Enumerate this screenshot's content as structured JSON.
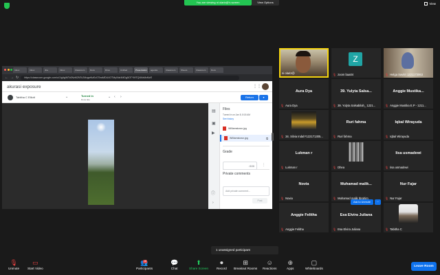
{
  "top": {
    "banner": "You are viewing ni olariz@'s screen",
    "view_options": "View Options",
    "view_label": "View"
  },
  "share": {
    "tabs": [
      "Inbox",
      "Inbox",
      "Jira",
      "Inbox",
      "Classroom",
      "Docs",
      "Drive",
      "Untitled",
      "Presentation",
      "agenda",
      "Classroom",
      "Sheets",
      "Classroom",
      "Docs"
    ],
    "url": "https://classroom.google.com/u/1/g/tg/MTc0NzM2NTc2MzgwNzEzOTcwMDU4OTMy/NzI4MDg5OTYMTQ4MzMzMzE",
    "course_title": "akurasi exposure",
    "student_name": "Tabitha C Elliott",
    "status": "Turned in",
    "status_sub": "Done late",
    "return_label": "Return",
    "files_heading": "Files",
    "files_sub": "Turned in on Jan 8, 8:18 AM",
    "see_history": "See history",
    "files": [
      "Williamstown.jpg",
      "Williamstown.jpg"
    ],
    "grade_heading": "Grade",
    "grade_value": "/100",
    "private_heading": "Private comments",
    "comment_placeholder": "Add private comment...",
    "post_label": "Post"
  },
  "gallery": [
    {
      "caption": "ni olariz@",
      "big": "",
      "kind": "video-person"
    },
    {
      "caption": "zoom baa04",
      "big": "",
      "kind": "avatar-z"
    },
    {
      "caption": "Helga Savitri 1221173063",
      "big": "",
      "kind": "video-hijab"
    },
    {
      "caption": "Aura Dya",
      "big": "Aura Dya",
      "kind": "name"
    },
    {
      "caption": "39. Yulyta Salsabilah_ 1221...",
      "big": "39. Yulyta Salsa...",
      "kind": "name"
    },
    {
      "caption": "Anggie Mustika E.P - 1211...",
      "big": "Anggie Mustika...",
      "kind": "name"
    },
    {
      "caption": "34. Silvia Indah*122171305...",
      "big": "",
      "kind": "video-dark"
    },
    {
      "caption": "Ruri fahma",
      "big": "Ruri fahma",
      "kind": "name"
    },
    {
      "caption": "Iqbal Wirayuda",
      "big": "Iqbal Wirayuda",
      "kind": "name"
    },
    {
      "caption": "Lukman r",
      "big": "Lukman r",
      "kind": "name"
    },
    {
      "caption": "Dhea",
      "big": "",
      "kind": "video-stripes"
    },
    {
      "caption": "Iisa usmadewi",
      "big": "Iisa usmadewi",
      "kind": "name"
    },
    {
      "caption": "Novia",
      "big": "Novia",
      "kind": "name"
    },
    {
      "caption": "Muhamad malik Ibrahim",
      "big": "Muhamad malik...",
      "kind": "name"
    },
    {
      "caption": "Nur Fajar",
      "big": "Nur Fajar",
      "kind": "name"
    },
    {
      "caption": "Anggie Felitha",
      "big": "Anggie Felitha",
      "kind": "name"
    },
    {
      "caption": "Esa Elvira Juliana",
      "big": "Esa Elvira Juliana",
      "kind": "name"
    },
    {
      "caption": "Tabitha C",
      "big": "",
      "kind": "video-photo"
    }
  ],
  "ask_unmute": "Ask to Unmute",
  "unassigned": "1 unassigned participant",
  "toolbar": {
    "unmute": "Unmute",
    "start_video": "Start Video",
    "participants": "Participants",
    "participants_count": "18",
    "chat": "Chat",
    "share_screen": "Share Screen",
    "record": "Record",
    "breakout": "Breakout Rooms",
    "reactions": "Reactions",
    "apps": "Apps",
    "whiteboards": "Whiteboards",
    "leave": "Leave Room"
  },
  "colors": {
    "accent": "#0e72ed",
    "green": "#23c552",
    "active_speaker": "#f5d40f",
    "muted": "#e34040"
  }
}
